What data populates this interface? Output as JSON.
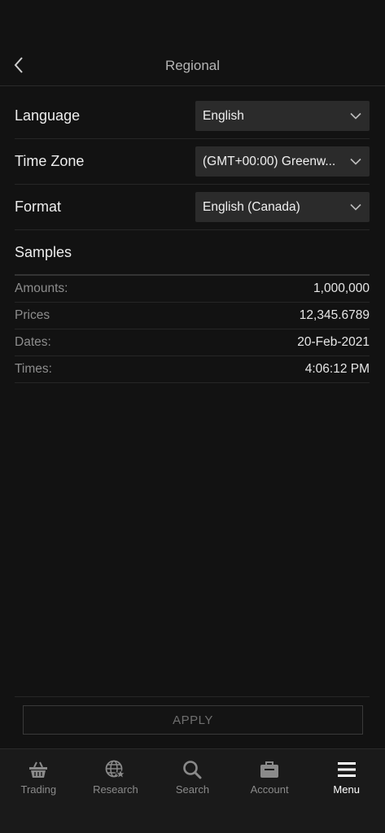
{
  "header": {
    "title": "Regional"
  },
  "settings": [
    {
      "label": "Language",
      "value": "English"
    },
    {
      "label": "Time Zone",
      "value": "(GMT+00:00) Greenw..."
    },
    {
      "label": "Format",
      "value": "English (Canada)"
    }
  ],
  "samples": {
    "title": "Samples",
    "rows": [
      {
        "label": "Amounts:",
        "value": "1,000,000"
      },
      {
        "label": "Prices",
        "value": "12,345.6789"
      },
      {
        "label": "Dates:",
        "value": "20-Feb-2021"
      },
      {
        "label": "Times:",
        "value": "4:06:12 PM"
      }
    ]
  },
  "apply": {
    "label": "APPLY"
  },
  "tabbar": {
    "tabs": [
      {
        "label": "Trading",
        "icon": "basket-icon"
      },
      {
        "label": "Research",
        "icon": "globe-star-icon"
      },
      {
        "label": "Search",
        "icon": "search-icon"
      },
      {
        "label": "Account",
        "icon": "briefcase-icon"
      },
      {
        "label": "Menu",
        "icon": "menu-icon",
        "active": true
      }
    ]
  },
  "colors": {
    "background": "#121212",
    "control": "#2b2b2b",
    "inactive_tab": "#8a8a8a",
    "active_tab": "#ffffff"
  }
}
